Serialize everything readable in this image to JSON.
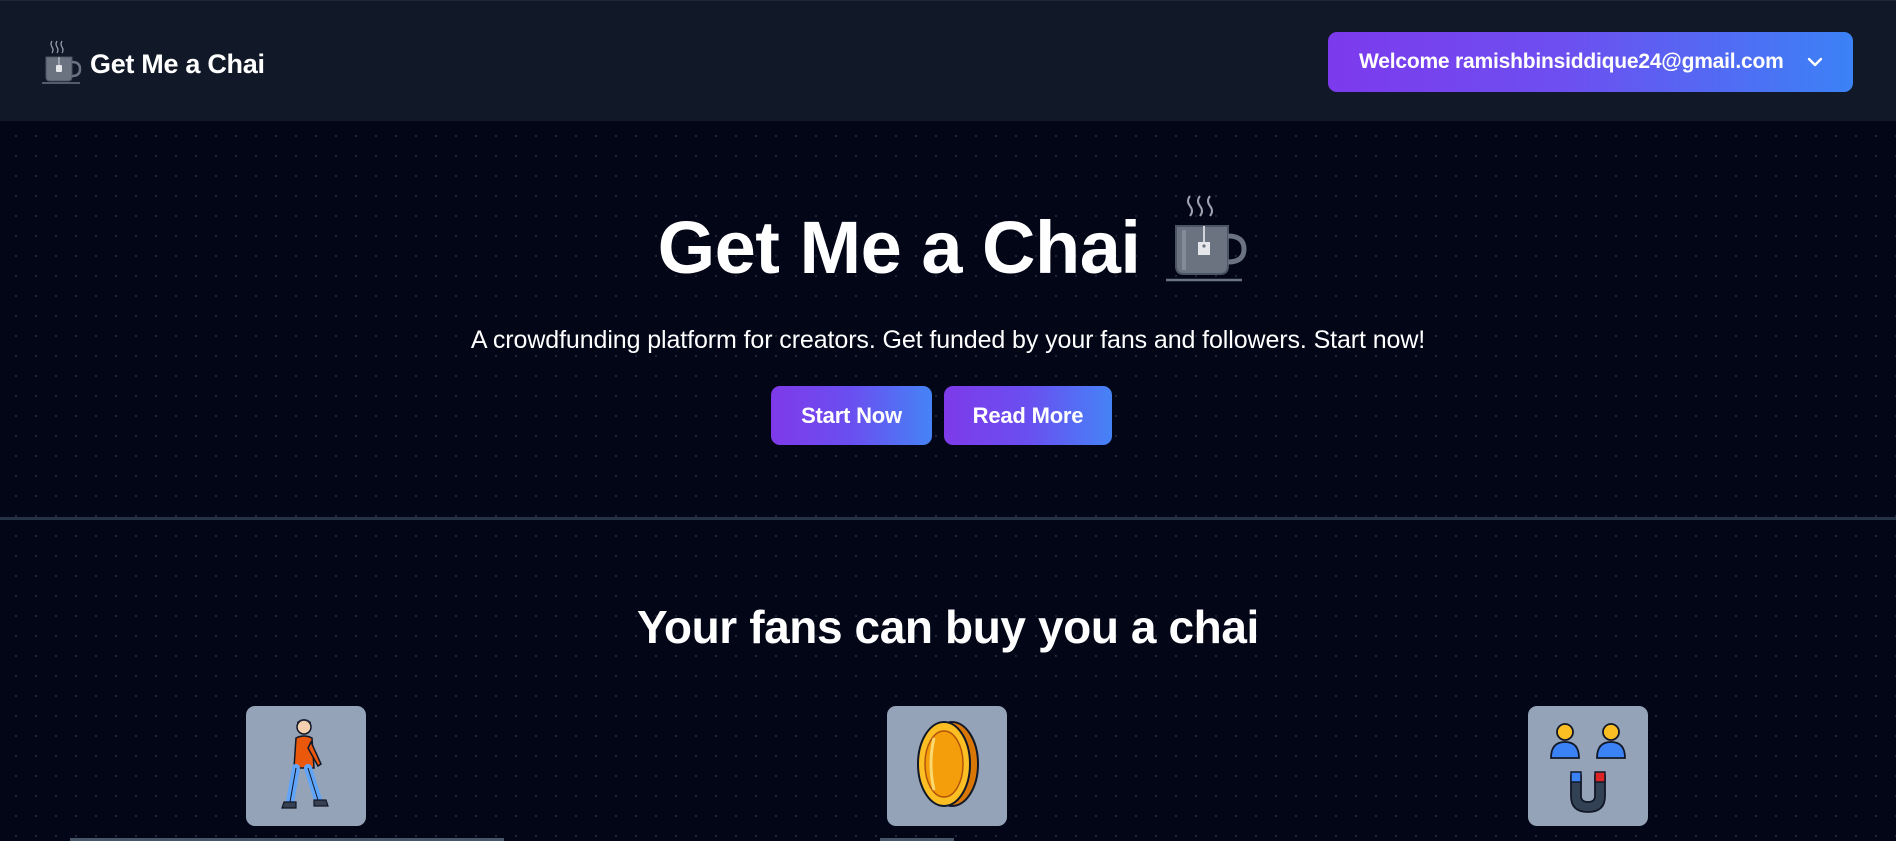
{
  "navbar": {
    "brand_text": "Get Me a Chai",
    "brand_icon": "tea-mug-icon",
    "welcome_label": "Welcome ramishbinsiddique24@gmail.com",
    "dropdown_icon": "chevron-down-icon"
  },
  "hero": {
    "title": "Get Me a Chai",
    "title_icon": "tea-mug-icon",
    "subtitle": "A crowdfunding platform for creators. Get funded by your fans and followers. Start now!",
    "buttons": {
      "start_label": "Start Now",
      "read_label": "Read More"
    }
  },
  "section": {
    "title": "Your fans can buy you a chai",
    "features": [
      {
        "icon": "walking-person-icon"
      },
      {
        "icon": "gold-coin-icon"
      },
      {
        "icon": "people-magnet-icon"
      }
    ]
  },
  "colors": {
    "page_bg": "#020617",
    "navbar_bg": "#111827",
    "gradient_start": "#7c3aed",
    "gradient_end": "#3b82f6",
    "card_bg": "#94a3b8"
  }
}
